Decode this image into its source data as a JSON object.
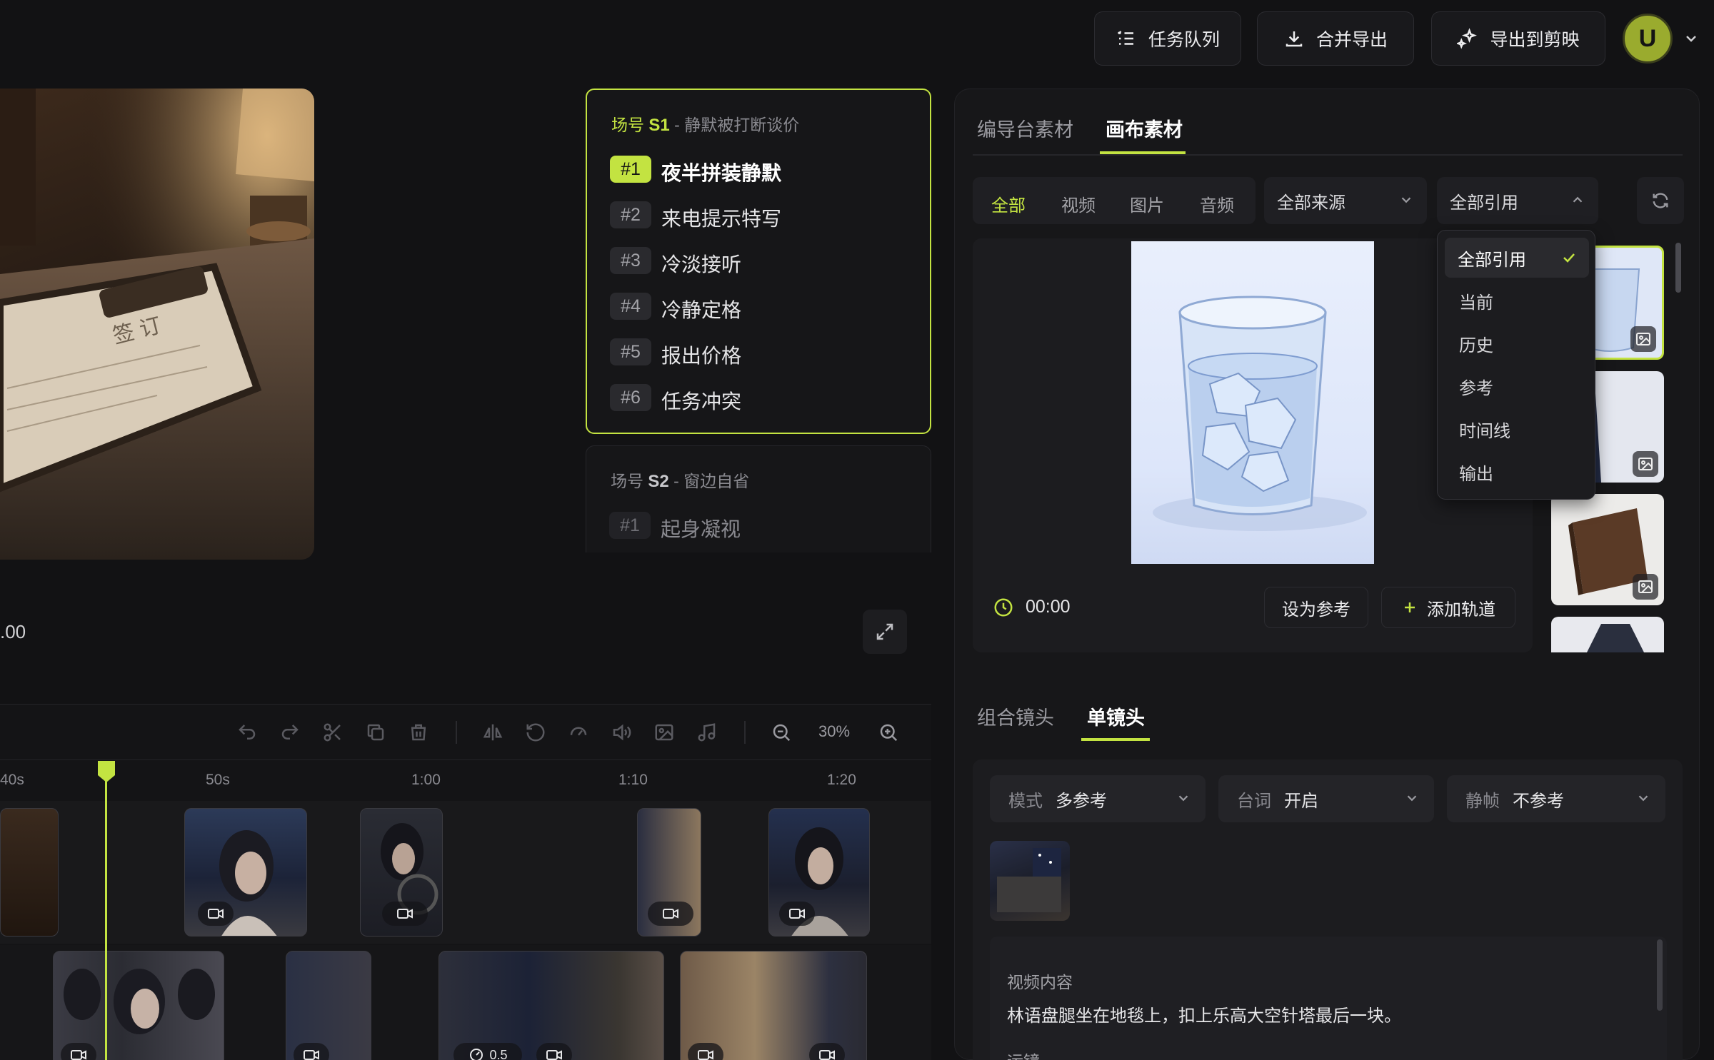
{
  "topbar": {
    "task_queue": "任务队列",
    "merge_export": "合并导出",
    "export_jianying": "导出到剪映",
    "avatar_letter": "U"
  },
  "preview": {
    "time_partial": ".00"
  },
  "scenes": [
    {
      "prefix": "场号",
      "id": "S1",
      "sep": "-",
      "name": "静默被打断谈价",
      "shots": [
        {
          "num": "#1",
          "title": "夜半拼装静默"
        },
        {
          "num": "#2",
          "title": "来电提示特写"
        },
        {
          "num": "#3",
          "title": "冷淡接听"
        },
        {
          "num": "#4",
          "title": "冷静定格"
        },
        {
          "num": "#5",
          "title": "报出价格"
        },
        {
          "num": "#6",
          "title": "任务冲突"
        }
      ]
    },
    {
      "prefix": "场号",
      "id": "S2",
      "sep": "-",
      "name": "窗边自省",
      "shots": [
        {
          "num": "#1",
          "title": "起身凝视"
        }
      ]
    }
  ],
  "timeline": {
    "zoom": "30%",
    "ruler": [
      "40s",
      "50s",
      "1:00",
      "1:10",
      "1:20"
    ],
    "speed_label": "0.5"
  },
  "assets": {
    "tabs": [
      "编导台素材",
      "画布素材"
    ],
    "active_tab": "画布素材",
    "filters": [
      "全部",
      "视频",
      "图片",
      "音频"
    ],
    "source_select": "全部来源",
    "ref_select": "全部引用",
    "dropdown": [
      "全部引用",
      "当前",
      "历史",
      "参考",
      "时间线",
      "输出"
    ],
    "selected_option": "全部引用",
    "time": "00:00",
    "set_ref": "设为参考",
    "add_track": "添加轨道"
  },
  "shot_panel": {
    "tabs": [
      "组合镜头",
      "单镜头"
    ],
    "active_tab": "单镜头",
    "mode_label": "模式",
    "mode_value": "多参考",
    "dialog_label": "台词",
    "dialog_value": "开启",
    "still_label": "静帧",
    "still_value": "不参考",
    "content_label": "视频内容",
    "content_text": "林语盘腿坐在地毯上，扣上乐高大空针塔最后一块。",
    "camera_label": "运镜"
  },
  "colors": {
    "accent": "#c3e341",
    "bg": "#121214",
    "panel": "#171719"
  }
}
